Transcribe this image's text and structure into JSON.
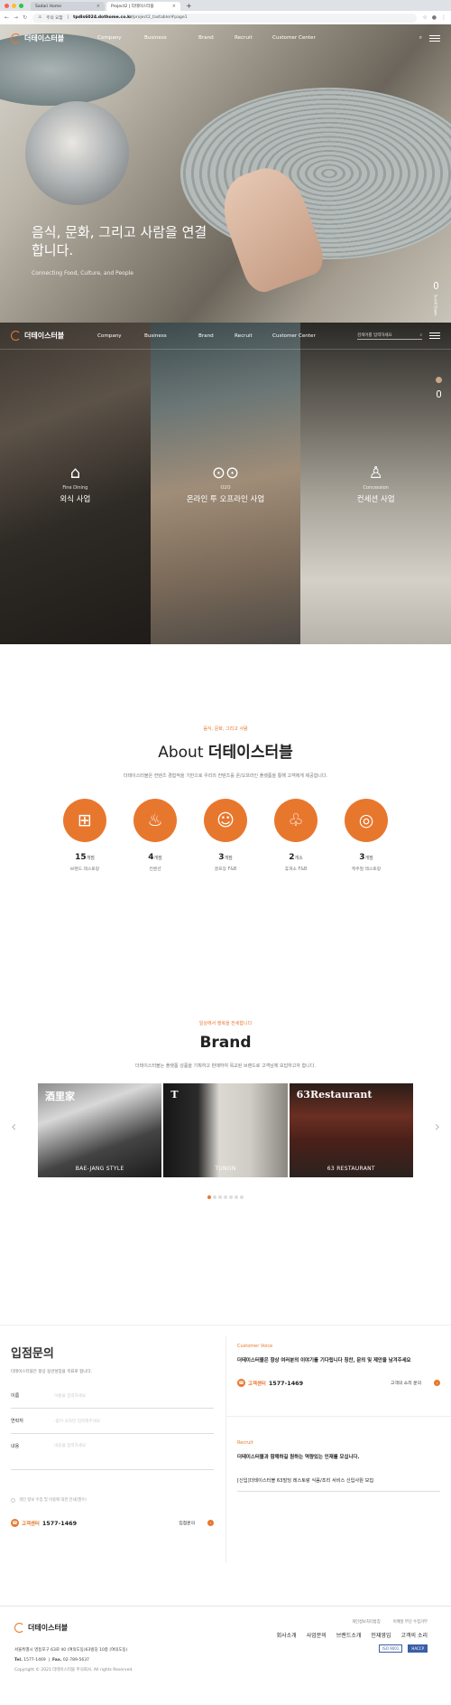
{
  "browser": {
    "tabs": [
      {
        "label": "Sadari Home",
        "active": false
      },
      {
        "label": "Project2 | 더테이스터블",
        "active": true
      }
    ],
    "new_tab": "+",
    "url_security": "주의 요함",
    "url_host": "tpdls6024.dothome.co.kr",
    "url_path": "/project2_tastable/#page1"
  },
  "header": {
    "logo": "더테이스터블",
    "nav": [
      "Company",
      "Business",
      "Brand",
      "Recruit",
      "Customer Center"
    ],
    "search_placeholder": "검색어를 입력하세요"
  },
  "hero": {
    "title": "음식, 문화, 그리고 사람을 연결 합니다.",
    "subtitle": "Connecting Food, Culture, and People",
    "scroll_label": "Scroll Down"
  },
  "business": {
    "panels": [
      {
        "icon": "fine-dining-icon",
        "en": "Fine Dining",
        "ko": "외식 사업"
      },
      {
        "icon": "o2o-icon",
        "en": "O2O",
        "ko": "온라인 투 오프라인 사업"
      },
      {
        "icon": "concession-icon",
        "en": "Concession",
        "ko": "컨세션 사업"
      }
    ]
  },
  "about": {
    "eyebrow": "음식, 문화, 그리고 사람",
    "title_prefix": "About",
    "title_strong": "더테이스터블",
    "desc": "더테이스터블은 컨텐츠 경험적을 기반으로 우리의 컨텐츠를 온/오프라인 플랫폼을 통해 고객에게 제공합니다.",
    "stats": [
      {
        "icon": "restaurant-icon",
        "num": "15",
        "unit": "개점",
        "label": "브랜드 레스토랑"
      },
      {
        "icon": "cafe-icon",
        "num": "4",
        "unit": "개점",
        "label": "컨벤션"
      },
      {
        "icon": "dining-icon",
        "num": "3",
        "unit": "개점",
        "label": "골프장 F&B"
      },
      {
        "icon": "rest-area-icon",
        "num": "2",
        "unit": "개소",
        "label": "휴게소 F&B"
      },
      {
        "icon": "catering-icon",
        "num": "3",
        "unit": "개점",
        "label": "케주얼 레스토랑"
      }
    ]
  },
  "brand": {
    "eyebrow": "일상에서 행복을 전세합니다",
    "title": "Brand",
    "desc": "더테이스터블는 플랫폼 성품을 기획하고 판매하여 목교된 브랜드로 고객님께 보답하고자 합니다.",
    "cards": [
      {
        "top": "酒里家",
        "caption": "BAE-JANG STYLE"
      },
      {
        "top": "T",
        "caption": "TUNON"
      },
      {
        "top": "63Restaurant",
        "caption": "63 RESTAURANT"
      }
    ],
    "pages": 7,
    "active_page": 1,
    "prev_arrow": "‹",
    "next_arrow": "›"
  },
  "contact": {
    "title": "입점문의",
    "desc": "더테이스터블은 항상 동반성장을 목표로 합니다.",
    "fields": [
      {
        "label": "이름",
        "placeholder": "이름을 입력하세요"
      },
      {
        "label": "연락처",
        "placeholder": "-없이 숫자만 입력해주세요"
      },
      {
        "label": "내용",
        "placeholder": "내용을 입력하세요"
      }
    ],
    "agree": "개인 정보 수집 및 이용에 대한 안내(필수)",
    "cc_label": "고객센터",
    "cc_number": "1577-1469",
    "submit": "입점문의"
  },
  "voice": {
    "tag": "Customer Voice",
    "text": "더테이스터블은 항상 여러분의 이야기를 기다립니다 칭찬, 문의 및 제안을 남겨주세요",
    "cc_label": "고객센터",
    "cc_number": "1577-1469",
    "link": "고객의 소리 문의"
  },
  "recruit": {
    "tag": "Recruit",
    "text": "더테이스터블과 함께하길 원하는 역량있는 인재를 모십니다.",
    "item": "[신입]더테이스터블 63빌딩 레스토랑 식음/조리 서비스 신입사원 모집"
  },
  "footer": {
    "logo": "더테이스터블",
    "top_links": [
      "개인정보처리방침",
      "이메일 무단 수집거부"
    ],
    "links": [
      "회사소개",
      "사업문의",
      "브랜드소개",
      "인재영입",
      "고객의 소리"
    ],
    "address": "서울특별시 영등포구 63로 40 (여의도동)63빌딩 10층 (여의도동)",
    "tel_label": "Tel.",
    "tel": "1577-1469",
    "fax_label": "Fax.",
    "fax": "02-789-5637",
    "copyright": "Copyright © 2021 더테이스터블 주식회사. All rights Reserved.",
    "badges": [
      "ISO 9001",
      "HACCP"
    ]
  },
  "colors": {
    "accent": "#e8772e"
  }
}
